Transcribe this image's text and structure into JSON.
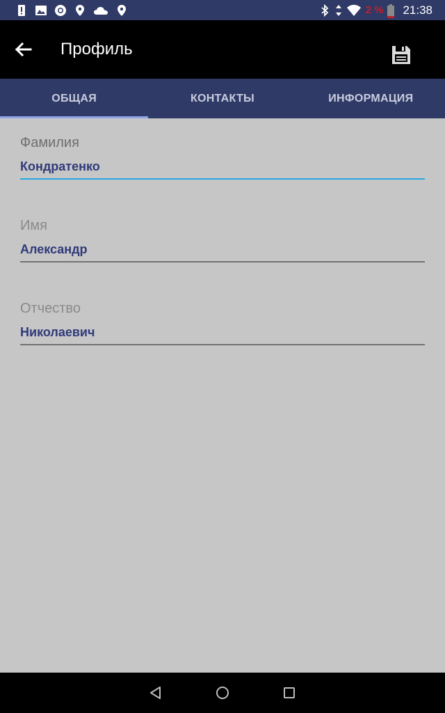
{
  "status_bar": {
    "left_icons": [
      "alert-icon",
      "image-icon",
      "chrome-icon",
      "location-icon",
      "cloud-icon",
      "location-icon"
    ],
    "right_icons": [
      "bluetooth-icon",
      "data-arrows-icon",
      "wifi-icon"
    ],
    "battery_percent": "2 %",
    "time": "21:38"
  },
  "app_bar": {
    "title": "Профиль",
    "back_icon": "arrow-back-icon",
    "save_icon": "save-icon"
  },
  "tabs": [
    {
      "label": "ОБЩАЯ",
      "active": true
    },
    {
      "label": "КОНТАКТЫ",
      "active": false
    },
    {
      "label": "ИНФОРМАЦИЯ",
      "active": false
    }
  ],
  "form": {
    "last_name": {
      "label": "Фамилия",
      "value": "Кондратенко"
    },
    "first_name": {
      "label": "Имя",
      "value": "Александр"
    },
    "patronymic": {
      "label": "Отчество",
      "value": "Николаевич"
    }
  },
  "nav_bar": {
    "back": "nav-back-icon",
    "home": "nav-home-icon",
    "recents": "nav-recents-icon"
  },
  "colors": {
    "primary": "#2f3a66",
    "accent_underline": "#2aa6e0",
    "value_text": "#2f3a7a",
    "background": "#c6c6c6",
    "battery_warning": "#c41f2a"
  }
}
